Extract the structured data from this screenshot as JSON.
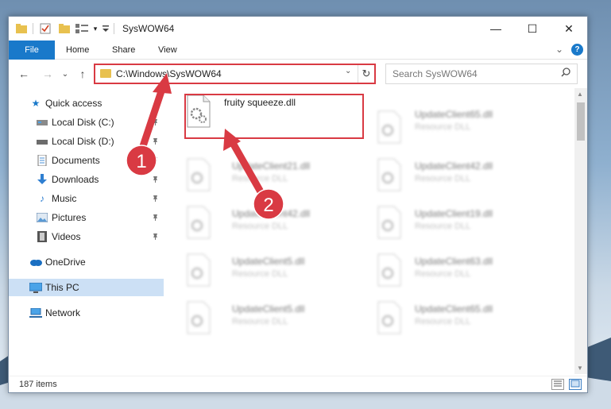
{
  "window": {
    "title": "SysWOW64",
    "controls": {
      "minimize": "—",
      "maximize": "☐",
      "close": "✕"
    },
    "qa_customize": "▾"
  },
  "ribbon": {
    "tabs": [
      "File",
      "Home",
      "Share",
      "View"
    ],
    "expand": "⌄",
    "help": "?"
  },
  "nav": {
    "back": "←",
    "forward": "→",
    "recent": "⌄",
    "up": "↑",
    "address": "C:\\Windows\\SysWOW64",
    "address_dropdown": "⌄",
    "refresh": "↻",
    "search_placeholder": "Search SysWOW64"
  },
  "sidebar": {
    "items": [
      {
        "label": "Quick access",
        "icon": "star-icon"
      },
      {
        "label": "Local Disk (C:)",
        "icon": "drive-icon"
      },
      {
        "label": "Local Disk (D:)",
        "icon": "drive-icon"
      },
      {
        "label": "Documents",
        "icon": "documents-icon"
      },
      {
        "label": "Downloads",
        "icon": "download-icon"
      },
      {
        "label": "Music",
        "icon": "music-icon"
      },
      {
        "label": "Pictures",
        "icon": "pictures-icon"
      },
      {
        "label": "Videos",
        "icon": "videos-icon"
      },
      {
        "label": "OneDrive",
        "icon": "cloud-icon"
      },
      {
        "label": "This PC",
        "icon": "computer-icon",
        "selected": true
      },
      {
        "label": "Network",
        "icon": "network-icon"
      }
    ]
  },
  "files": [
    {
      "name": "fruity squeeze.dll",
      "type": ""
    },
    {
      "name": "UpdateClient65.dll",
      "type": "Resource DLL"
    },
    {
      "name": "UpdateClient21.dll",
      "type": "Resource DLL"
    },
    {
      "name": "UpdateClient42.dll",
      "type": "Resource DLL"
    },
    {
      "name": "UpdateClient42.dll",
      "type": "Resource DLL"
    },
    {
      "name": "UpdateClient19.dll",
      "type": "Resource DLL"
    },
    {
      "name": "UpdateClient5.dll",
      "type": "Resource DLL"
    },
    {
      "name": "UpdateClient63.dll",
      "type": "Resource DLL"
    },
    {
      "name": "UpdateClient5.dll",
      "type": "Resource DLL"
    },
    {
      "name": "UpdateClient65.dll",
      "type": "Resource DLL"
    }
  ],
  "status": {
    "items": "187 items"
  },
  "annotations": {
    "step1": "1",
    "step2": "2"
  },
  "colors": {
    "accent": "#1979ca",
    "highlight": "#d93a43",
    "selected": "#cce0f5"
  }
}
